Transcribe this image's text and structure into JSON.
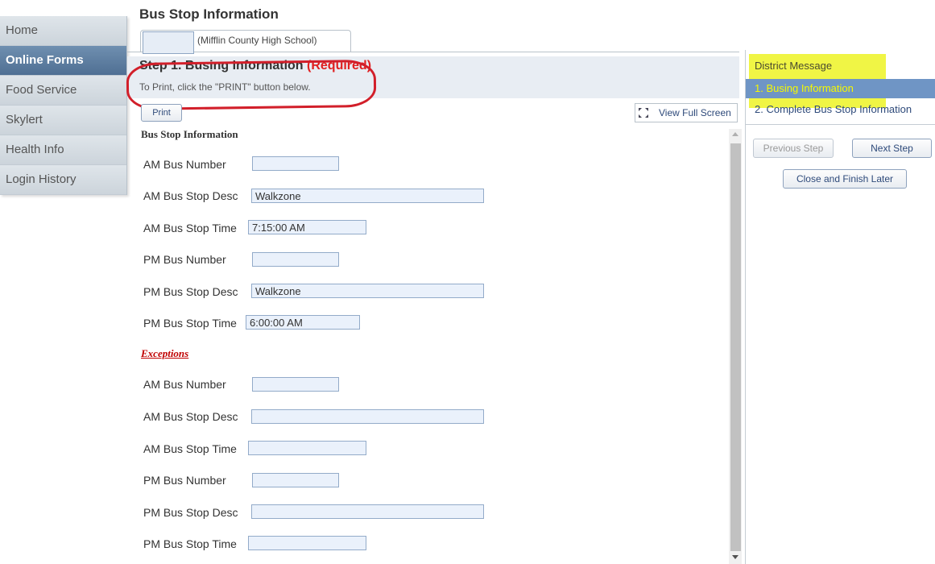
{
  "nav": {
    "items": [
      {
        "label": "Home",
        "active": false
      },
      {
        "label": "Online Forms",
        "active": true
      },
      {
        "label": "Food Service",
        "active": false
      },
      {
        "label": "Skylert",
        "active": false
      },
      {
        "label": "Health Info",
        "active": false
      },
      {
        "label": "Login History",
        "active": false
      }
    ]
  },
  "page": {
    "title": "Bus Stop Information",
    "student_tab_label": "(Mifflin County High School)"
  },
  "step": {
    "title": "Step 1. Busing Information",
    "required": "(Required)",
    "print_hint": "To Print, click the \"PRINT\" button below."
  },
  "toolbar": {
    "print_label": "Print",
    "fullscreen_label": "View Full Screen"
  },
  "form": {
    "section_title": "Bus Stop Information",
    "fields": [
      {
        "label": "AM Bus Number",
        "value": ""
      },
      {
        "label": "AM Bus Stop Desc",
        "value": "Walkzone"
      },
      {
        "label": "AM Bus Stop Time",
        "value": "7:15:00 AM"
      },
      {
        "label": "PM Bus Number",
        "value": ""
      },
      {
        "label": "PM Bus Stop Desc",
        "value": "Walkzone"
      },
      {
        "label": "PM Bus Stop Time",
        "value": "6:00:00 AM"
      }
    ],
    "exceptions_title": "Exceptions",
    "exception_fields": [
      {
        "label": "AM Bus Number",
        "value": ""
      },
      {
        "label": "AM Bus Stop Desc",
        "value": ""
      },
      {
        "label": "AM Bus Stop Time",
        "value": ""
      },
      {
        "label": "PM Bus Number",
        "value": ""
      },
      {
        "label": "PM Bus Stop Desc",
        "value": ""
      },
      {
        "label": "PM Bus Stop Time",
        "value": ""
      }
    ]
  },
  "steps_panel": {
    "items": [
      {
        "label": "District Message"
      },
      {
        "label": "1. Busing Information"
      },
      {
        "label": "2. Complete Bus Stop Information"
      }
    ],
    "prev_label": "Previous Step",
    "next_label": "Next Step",
    "close_label": "Close and Finish Later"
  },
  "colors": {
    "highlight": "#f0f545",
    "annotation_circle": "#d21f2a",
    "active_nav": "#5a7a9c",
    "active_step": "#6f95c5",
    "required": "#e02020"
  }
}
